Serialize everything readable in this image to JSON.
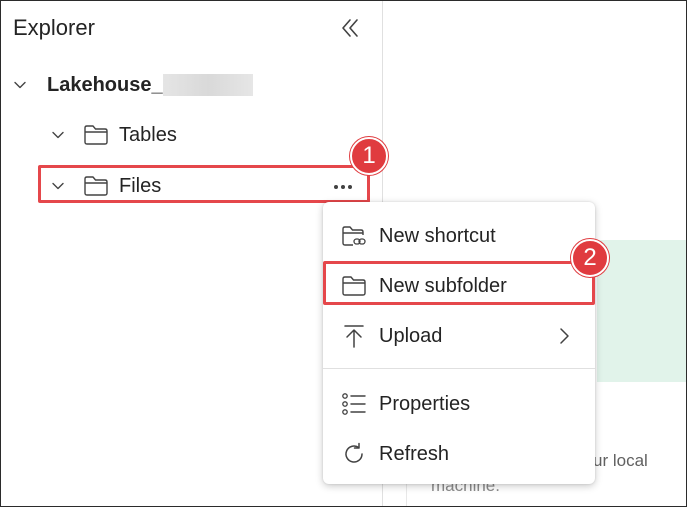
{
  "explorer": {
    "title": "Explorer",
    "collapse_icon": "double-chevron-left-icon",
    "tree": {
      "lakehouse": {
        "label": "Lakehouse_",
        "icon": "chevron-down-icon"
      },
      "tables": {
        "label": "Tables",
        "icon": "folder-icon"
      },
      "files": {
        "label": "Files",
        "icon": "folder-icon",
        "more_icon": "more-horizontal-icon"
      }
    }
  },
  "context_menu": {
    "items": [
      {
        "label": "New shortcut",
        "icon": "folder-link-icon"
      },
      {
        "label": "New subfolder",
        "icon": "folder-icon"
      },
      {
        "label": "Upload",
        "icon": "upload-icon",
        "has_submenu": true
      },
      {
        "label": "Properties",
        "icon": "list-icon"
      },
      {
        "label": "Refresh",
        "icon": "refresh-icon"
      }
    ]
  },
  "badges": {
    "step1": "1",
    "step2": "2"
  },
  "background": {
    "text_line1": "ur local",
    "text_line2": "machine."
  },
  "colors": {
    "highlight": "#e5474b",
    "badge": "#e03b3f",
    "green_card": "#e1f3ea",
    "text": "#242424"
  }
}
